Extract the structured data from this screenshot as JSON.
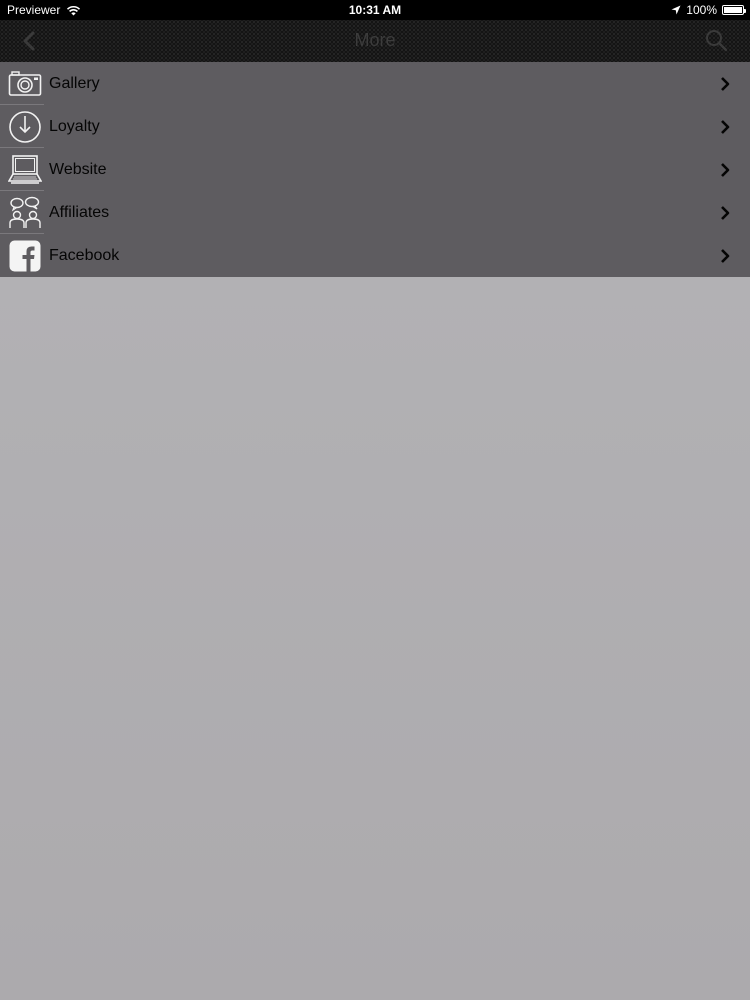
{
  "status_bar": {
    "carrier": "Previewer",
    "time": "10:31 AM",
    "battery": "100%",
    "battery_level": 1.0
  },
  "nav": {
    "title": "More",
    "back_icon": "chevron-left-icon",
    "search_icon": "search-icon"
  },
  "menu": {
    "items": [
      {
        "label": "Gallery",
        "icon": "camera-icon"
      },
      {
        "label": "Loyalty",
        "icon": "clock-arrow-icon"
      },
      {
        "label": "Website",
        "icon": "laptop-icon"
      },
      {
        "label": "Affiliates",
        "icon": "people-chat-icon"
      },
      {
        "label": "Facebook",
        "icon": "facebook-icon"
      }
    ]
  },
  "colors": {
    "menu_background": "#5e5c60",
    "content_background": "#b0afb2",
    "nav_background": "#141414"
  }
}
